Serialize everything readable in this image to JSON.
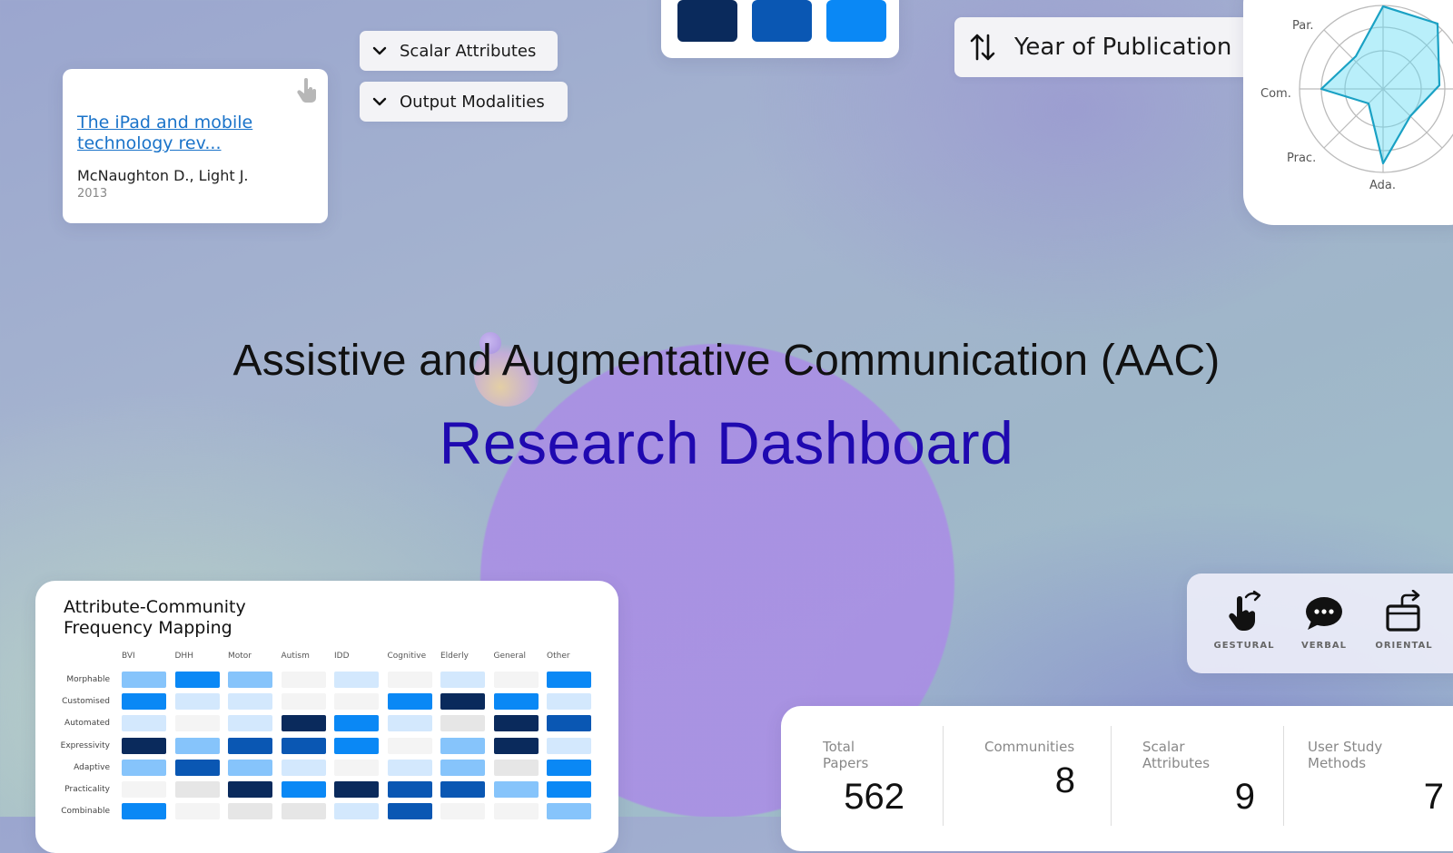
{
  "paper_card": {
    "title": "The iPad and mobile technology rev...",
    "authors": "McNaughton D., Light J.",
    "year": "2013"
  },
  "filters": {
    "scalar_label": "Scalar Attributes",
    "output_label": "Output Modalities"
  },
  "swatches": [
    "#0a2a5c",
    "#0a57b3",
    "#0a88f5"
  ],
  "sort": {
    "label": "Year of Publication",
    "icon": "sort-arrows-icon"
  },
  "radar": {
    "labels": [
      "Par.",
      "Com.",
      "Prac.",
      "Ada."
    ]
  },
  "hero": {
    "title": "Assistive and Augmentative Communication (AAC)",
    "subtitle": "Research Dashboard"
  },
  "heatmap": {
    "title": "Attribute-Community Frequency Mapping",
    "columns": [
      "BVI",
      "DHH",
      "Motor",
      "Autism",
      "IDD",
      "Cognitive",
      "Elderly",
      "General",
      "Other"
    ],
    "rows": [
      "Morphable",
      "Customised",
      "Automated",
      "Expressivity",
      "Adaptive",
      "Practicality",
      "Combinable"
    ],
    "levels": [
      [
        2,
        4,
        2,
        0,
        1,
        0,
        1,
        0,
        4
      ],
      [
        4,
        1,
        1,
        0,
        0,
        4,
        5,
        4,
        1
      ],
      [
        1,
        0,
        1,
        5,
        4,
        1,
        6,
        5,
        3
      ],
      [
        5,
        2,
        3,
        3,
        4,
        0,
        2,
        5,
        1
      ],
      [
        2,
        3,
        2,
        1,
        0,
        1,
        2,
        6,
        4
      ],
      [
        0,
        6,
        5,
        4,
        5,
        3,
        3,
        2,
        4
      ],
      [
        4,
        0,
        6,
        6,
        1,
        3,
        0,
        0,
        2
      ]
    ],
    "palette": [
      "#f4f4f4",
      "#d3e8fd",
      "#86c4fb",
      "#0a57b3",
      "#0a88f5",
      "#0a2a5c",
      "#e6e6e6"
    ]
  },
  "modalities": [
    {
      "label": "GESTURAL",
      "icon": "gesture-hand-icon"
    },
    {
      "label": "VERBAL",
      "icon": "speech-bubble-icon"
    },
    {
      "label": "ORIENTAL",
      "icon": "rotate-device-icon"
    }
  ],
  "stats": [
    {
      "label": "Total Papers",
      "value": "562"
    },
    {
      "label": "Communities",
      "value": "8"
    },
    {
      "label": "Scalar Attributes",
      "value": "9"
    },
    {
      "label": "User Study Methods",
      "value": "7"
    }
  ]
}
